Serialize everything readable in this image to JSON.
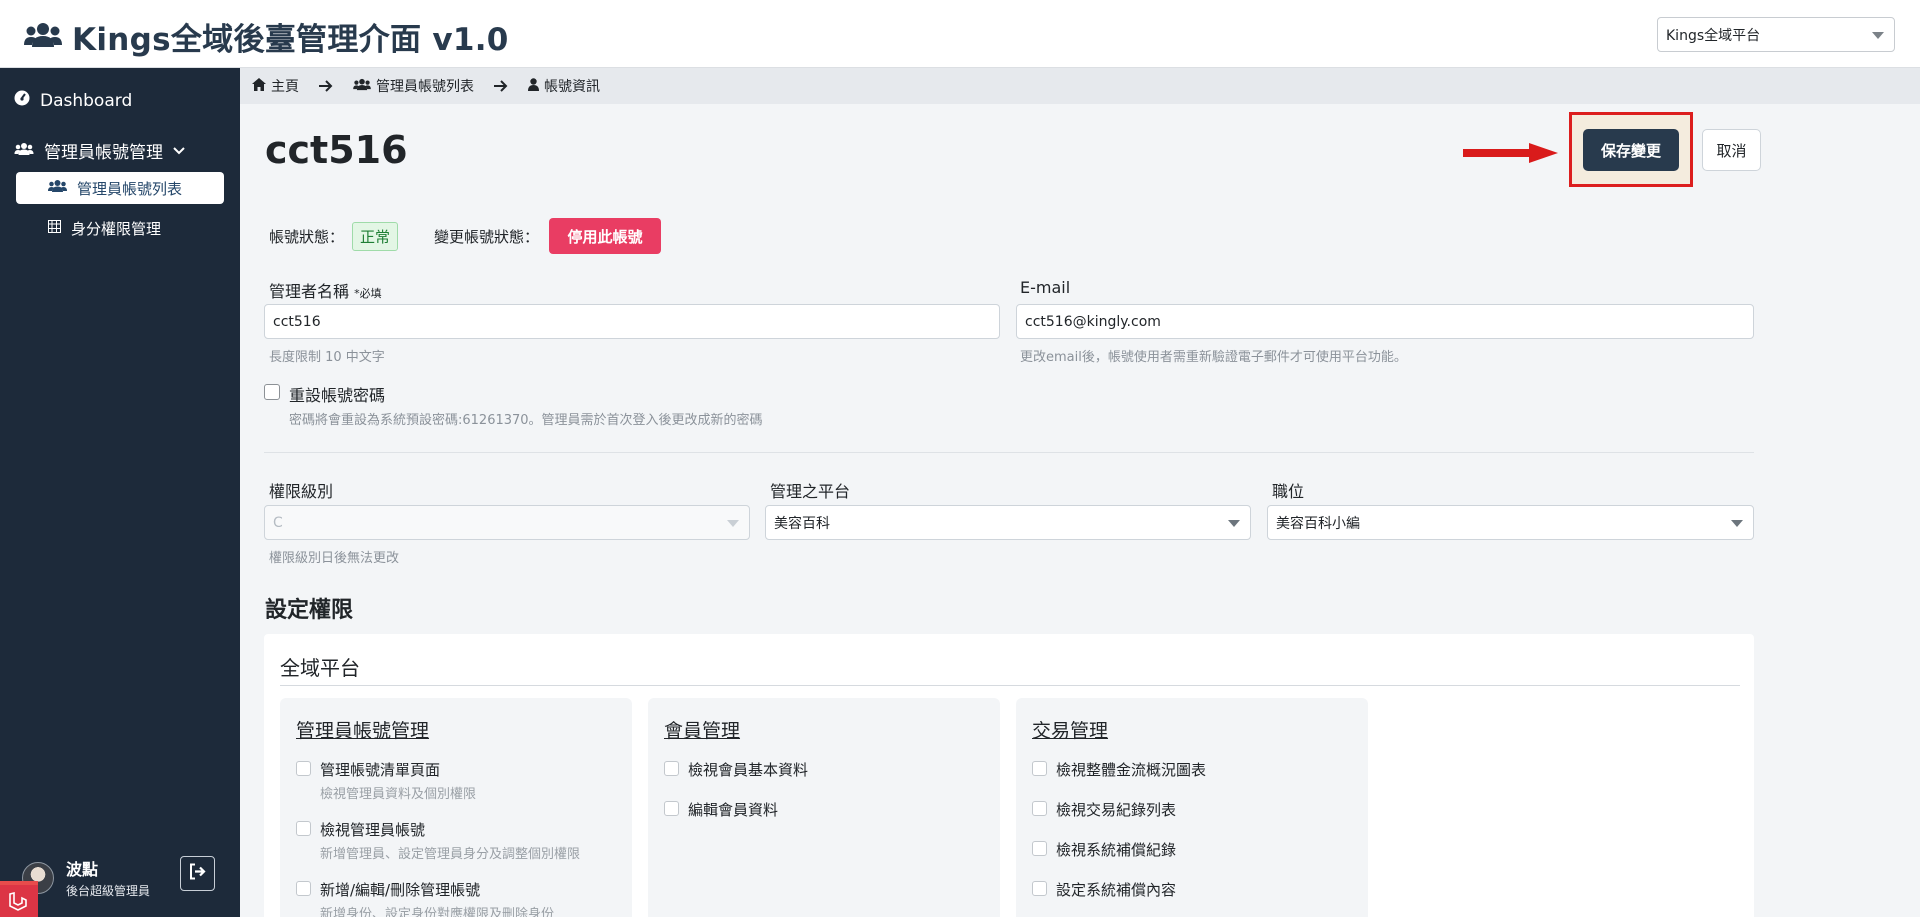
{
  "header": {
    "title": "Kings全域後臺管理介面 v1.0",
    "platform_select": "Kings全域平台"
  },
  "sidebar": {
    "dashboard": "Dashboard",
    "admin_group": "管理員帳號管理",
    "sub_items": [
      {
        "label": "管理員帳號列表",
        "active": true
      },
      {
        "label": "身分權限管理",
        "active": false
      }
    ],
    "user": {
      "name": "波點",
      "role": "後台超級管理員"
    }
  },
  "breadcrumb": [
    "主頁",
    "管理員帳號列表",
    "帳號資訊"
  ],
  "page": {
    "title": "cct516",
    "save_label": "保存變更",
    "cancel_label": "取消"
  },
  "status": {
    "label": "帳號狀態：",
    "value": "正常",
    "change_label": "變更帳號狀態：",
    "disable_label": "停用此帳號"
  },
  "form": {
    "name_label": "管理者名稱",
    "name_required": "*必填",
    "name_value": "cct516",
    "name_hint": "長度限制 10 中文字",
    "email_label": "E-mail",
    "email_value": "cct516@kingly.com",
    "email_hint": "更改email後，帳號使用者需重新驗證電子郵件才可使用平台功能。",
    "reset_label": "重設帳號密碼",
    "reset_hint": "密碼將會重設為系統預設密碼:61261370。管理員需於首次登入後更改成新的密碼",
    "level_label": "權限級別",
    "level_value": "C",
    "level_hint": "權限級別日後無法更改",
    "platform_label": "管理之平台",
    "platform_value": "美容百科",
    "position_label": "職位",
    "position_value": "美容百科小編"
  },
  "permissions": {
    "section_title": "設定權限",
    "card_title": "全域平台",
    "groups": [
      {
        "title": "管理員帳號管理",
        "items": [
          {
            "label": "管理帳號清單頁面",
            "desc": "檢視管理員資料及個別權限"
          },
          {
            "label": "檢視管理員帳號",
            "desc": "新增管理員、設定管理員身分及調整個別權限"
          },
          {
            "label": "新增/編輯/刪除管理帳號",
            "desc": "新增身份、設定身份對應權限及刪除身份"
          }
        ]
      },
      {
        "title": "會員管理",
        "items": [
          {
            "label": "檢視會員基本資料"
          },
          {
            "label": "編輯會員資料"
          }
        ]
      },
      {
        "title": "交易管理",
        "items": [
          {
            "label": "檢視整體金流概況圖表"
          },
          {
            "label": "檢視交易紀錄列表"
          },
          {
            "label": "檢視系統補償紀錄"
          },
          {
            "label": "設定系統補償內容"
          }
        ]
      }
    ]
  }
}
